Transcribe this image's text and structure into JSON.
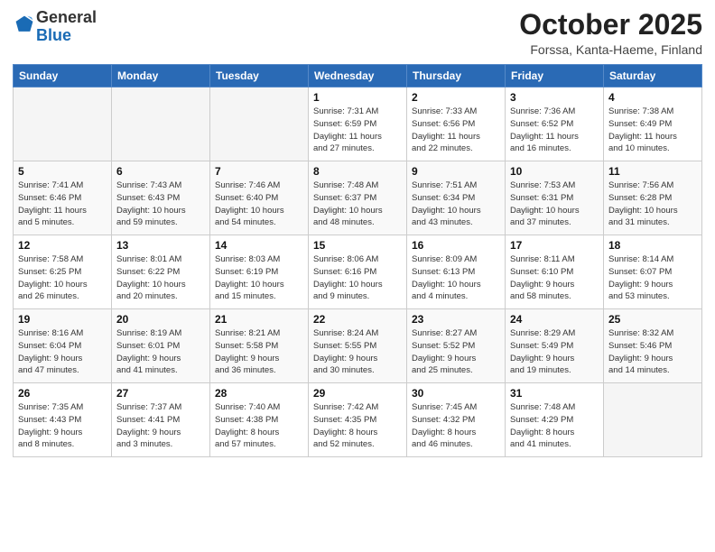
{
  "header": {
    "logo_general": "General",
    "logo_blue": "Blue",
    "month": "October 2025",
    "location": "Forssa, Kanta-Haeme, Finland"
  },
  "weekdays": [
    "Sunday",
    "Monday",
    "Tuesday",
    "Wednesday",
    "Thursday",
    "Friday",
    "Saturday"
  ],
  "weeks": [
    [
      {
        "day": "",
        "info": ""
      },
      {
        "day": "",
        "info": ""
      },
      {
        "day": "",
        "info": ""
      },
      {
        "day": "1",
        "info": "Sunrise: 7:31 AM\nSunset: 6:59 PM\nDaylight: 11 hours\nand 27 minutes."
      },
      {
        "day": "2",
        "info": "Sunrise: 7:33 AM\nSunset: 6:56 PM\nDaylight: 11 hours\nand 22 minutes."
      },
      {
        "day": "3",
        "info": "Sunrise: 7:36 AM\nSunset: 6:52 PM\nDaylight: 11 hours\nand 16 minutes."
      },
      {
        "day": "4",
        "info": "Sunrise: 7:38 AM\nSunset: 6:49 PM\nDaylight: 11 hours\nand 10 minutes."
      }
    ],
    [
      {
        "day": "5",
        "info": "Sunrise: 7:41 AM\nSunset: 6:46 PM\nDaylight: 11 hours\nand 5 minutes."
      },
      {
        "day": "6",
        "info": "Sunrise: 7:43 AM\nSunset: 6:43 PM\nDaylight: 10 hours\nand 59 minutes."
      },
      {
        "day": "7",
        "info": "Sunrise: 7:46 AM\nSunset: 6:40 PM\nDaylight: 10 hours\nand 54 minutes."
      },
      {
        "day": "8",
        "info": "Sunrise: 7:48 AM\nSunset: 6:37 PM\nDaylight: 10 hours\nand 48 minutes."
      },
      {
        "day": "9",
        "info": "Sunrise: 7:51 AM\nSunset: 6:34 PM\nDaylight: 10 hours\nand 43 minutes."
      },
      {
        "day": "10",
        "info": "Sunrise: 7:53 AM\nSunset: 6:31 PM\nDaylight: 10 hours\nand 37 minutes."
      },
      {
        "day": "11",
        "info": "Sunrise: 7:56 AM\nSunset: 6:28 PM\nDaylight: 10 hours\nand 31 minutes."
      }
    ],
    [
      {
        "day": "12",
        "info": "Sunrise: 7:58 AM\nSunset: 6:25 PM\nDaylight: 10 hours\nand 26 minutes."
      },
      {
        "day": "13",
        "info": "Sunrise: 8:01 AM\nSunset: 6:22 PM\nDaylight: 10 hours\nand 20 minutes."
      },
      {
        "day": "14",
        "info": "Sunrise: 8:03 AM\nSunset: 6:19 PM\nDaylight: 10 hours\nand 15 minutes."
      },
      {
        "day": "15",
        "info": "Sunrise: 8:06 AM\nSunset: 6:16 PM\nDaylight: 10 hours\nand 9 minutes."
      },
      {
        "day": "16",
        "info": "Sunrise: 8:09 AM\nSunset: 6:13 PM\nDaylight: 10 hours\nand 4 minutes."
      },
      {
        "day": "17",
        "info": "Sunrise: 8:11 AM\nSunset: 6:10 PM\nDaylight: 9 hours\nand 58 minutes."
      },
      {
        "day": "18",
        "info": "Sunrise: 8:14 AM\nSunset: 6:07 PM\nDaylight: 9 hours\nand 53 minutes."
      }
    ],
    [
      {
        "day": "19",
        "info": "Sunrise: 8:16 AM\nSunset: 6:04 PM\nDaylight: 9 hours\nand 47 minutes."
      },
      {
        "day": "20",
        "info": "Sunrise: 8:19 AM\nSunset: 6:01 PM\nDaylight: 9 hours\nand 41 minutes."
      },
      {
        "day": "21",
        "info": "Sunrise: 8:21 AM\nSunset: 5:58 PM\nDaylight: 9 hours\nand 36 minutes."
      },
      {
        "day": "22",
        "info": "Sunrise: 8:24 AM\nSunset: 5:55 PM\nDaylight: 9 hours\nand 30 minutes."
      },
      {
        "day": "23",
        "info": "Sunrise: 8:27 AM\nSunset: 5:52 PM\nDaylight: 9 hours\nand 25 minutes."
      },
      {
        "day": "24",
        "info": "Sunrise: 8:29 AM\nSunset: 5:49 PM\nDaylight: 9 hours\nand 19 minutes."
      },
      {
        "day": "25",
        "info": "Sunrise: 8:32 AM\nSunset: 5:46 PM\nDaylight: 9 hours\nand 14 minutes."
      }
    ],
    [
      {
        "day": "26",
        "info": "Sunrise: 7:35 AM\nSunset: 4:43 PM\nDaylight: 9 hours\nand 8 minutes."
      },
      {
        "day": "27",
        "info": "Sunrise: 7:37 AM\nSunset: 4:41 PM\nDaylight: 9 hours\nand 3 minutes."
      },
      {
        "day": "28",
        "info": "Sunrise: 7:40 AM\nSunset: 4:38 PM\nDaylight: 8 hours\nand 57 minutes."
      },
      {
        "day": "29",
        "info": "Sunrise: 7:42 AM\nSunset: 4:35 PM\nDaylight: 8 hours\nand 52 minutes."
      },
      {
        "day": "30",
        "info": "Sunrise: 7:45 AM\nSunset: 4:32 PM\nDaylight: 8 hours\nand 46 minutes."
      },
      {
        "day": "31",
        "info": "Sunrise: 7:48 AM\nSunset: 4:29 PM\nDaylight: 8 hours\nand 41 minutes."
      },
      {
        "day": "",
        "info": ""
      }
    ]
  ]
}
